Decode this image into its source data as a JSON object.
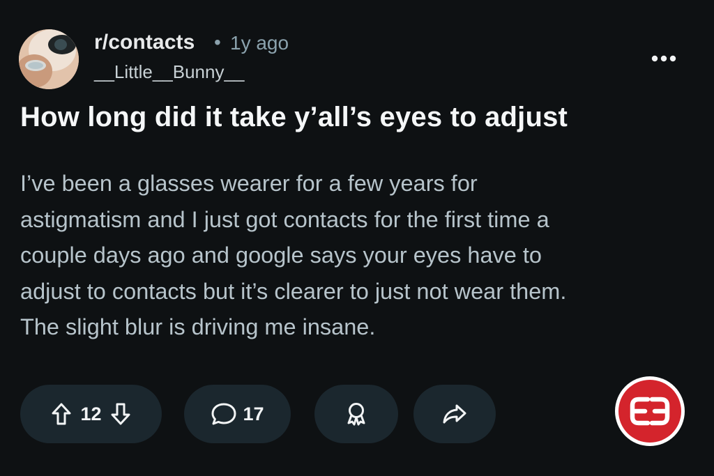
{
  "post": {
    "subreddit": "r/contacts",
    "separator": "•",
    "time_ago": "1y ago",
    "username": "__Little__Bunny__",
    "title": "How long did it take y’all’s eyes to adjust",
    "body": "I’ve been a glasses wearer for a few years for\nastigmatism and I just got contacts for the first time a\ncouple days ago and google says your eyes have to\nadjust to contacts but it’s clearer to just not wear them.\nThe slight blur is driving me insane."
  },
  "actions": {
    "vote_count": "12",
    "comment_count": "17"
  },
  "icons": {
    "more": "more-horizontal-icon",
    "upvote": "upvote-arrow-icon",
    "downvote": "downvote-arrow-icon",
    "comment": "comment-bubble-icon",
    "award": "award-icon",
    "share": "share-arrow-icon",
    "logo": "red-circle-logo-icon"
  },
  "colors": {
    "background": "#0e1113",
    "pill": "#1b272e",
    "body_text": "#b7c4cb",
    "meta_text": "#8ba2ad",
    "logo_red": "#d4242c"
  }
}
